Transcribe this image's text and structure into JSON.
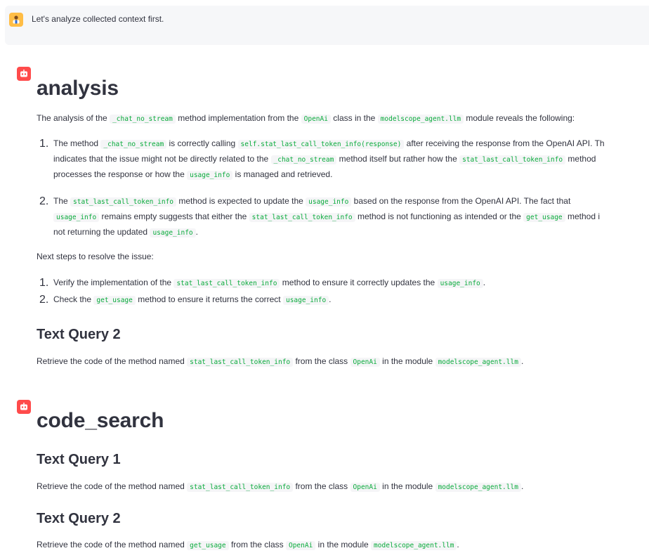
{
  "user_message": {
    "text": "Let's analyze collected context first."
  },
  "analysis": {
    "title": "analysis",
    "intro": {
      "t1": "The analysis of the ",
      "c1": "_chat_no_stream",
      "t2": " method implementation from the ",
      "c2": "OpenAi",
      "t3": " class in the ",
      "c3": "modelscope_agent.llm",
      "t4": " module reveals the following:"
    },
    "findings": [
      {
        "num": "1.",
        "l1a": "The method ",
        "l1c1": "_chat_no_stream",
        "l1b": " is correctly calling ",
        "l1c2": "self.stat_last_call_token_info(response)",
        "l1d": " after receiving the response from the OpenAI API. Th",
        "l2a": "indicates that the issue might not be directly related to the ",
        "l2c1": "_chat_no_stream",
        "l2b": " method itself but rather how the ",
        "l2c2": "stat_last_call_token_info",
        "l2d": " method",
        "l3a": "processes the response or how the ",
        "l3c1": "usage_info",
        "l3b": " is managed and retrieved."
      },
      {
        "num": "2.",
        "l1a": "The ",
        "l1c1": "stat_last_call_token_info",
        "l1b": " method is expected to update the ",
        "l1c2": "usage_info",
        "l1d": " based on the response from the OpenAI API. The fact that",
        "l2c1": "usage_info",
        "l2a": " remains empty suggests that either the ",
        "l2c2": "stat_last_call_token_info",
        "l2b": " method is not functioning as intended or the ",
        "l2c3": "get_usage",
        "l2d": " method i",
        "l3a": "not returning the updated ",
        "l3c1": "usage_info",
        "l3b": "."
      }
    ],
    "next_steps_label": "Next steps to resolve the issue:",
    "steps": [
      {
        "num": "1.",
        "a": "Verify the implementation of the ",
        "c1": "stat_last_call_token_info",
        "b": " method to ensure it correctly updates the ",
        "c2": "usage_info",
        "d": "."
      },
      {
        "num": "2.",
        "a": "Check the ",
        "c1": "get_usage",
        "b": " method to ensure it returns the correct ",
        "c2": "usage_info",
        "d": "."
      }
    ],
    "query2": {
      "heading": "Text Query 2",
      "a": "Retrieve the code of the method named ",
      "c1": "stat_last_call_token_info",
      "b": " from the class ",
      "c2": "OpenAi",
      "c": " in the module ",
      "c3": "modelscope_agent.llm",
      "d": "."
    }
  },
  "code_search": {
    "title": "code_search",
    "query1": {
      "heading": "Text Query 1",
      "a": "Retrieve the code of the method named ",
      "c1": "stat_last_call_token_info",
      "b": " from the class ",
      "c2": "OpenAi",
      "c": " in the module ",
      "c3": "modelscope_agent.llm",
      "d": "."
    },
    "query2": {
      "heading": "Text Query 2",
      "a": "Retrieve the code of the method named ",
      "c1": "get_usage",
      "b": " from the class ",
      "c2": "OpenAi",
      "c": " in the module ",
      "c3": "modelscope_agent.llm",
      "d": "."
    }
  }
}
